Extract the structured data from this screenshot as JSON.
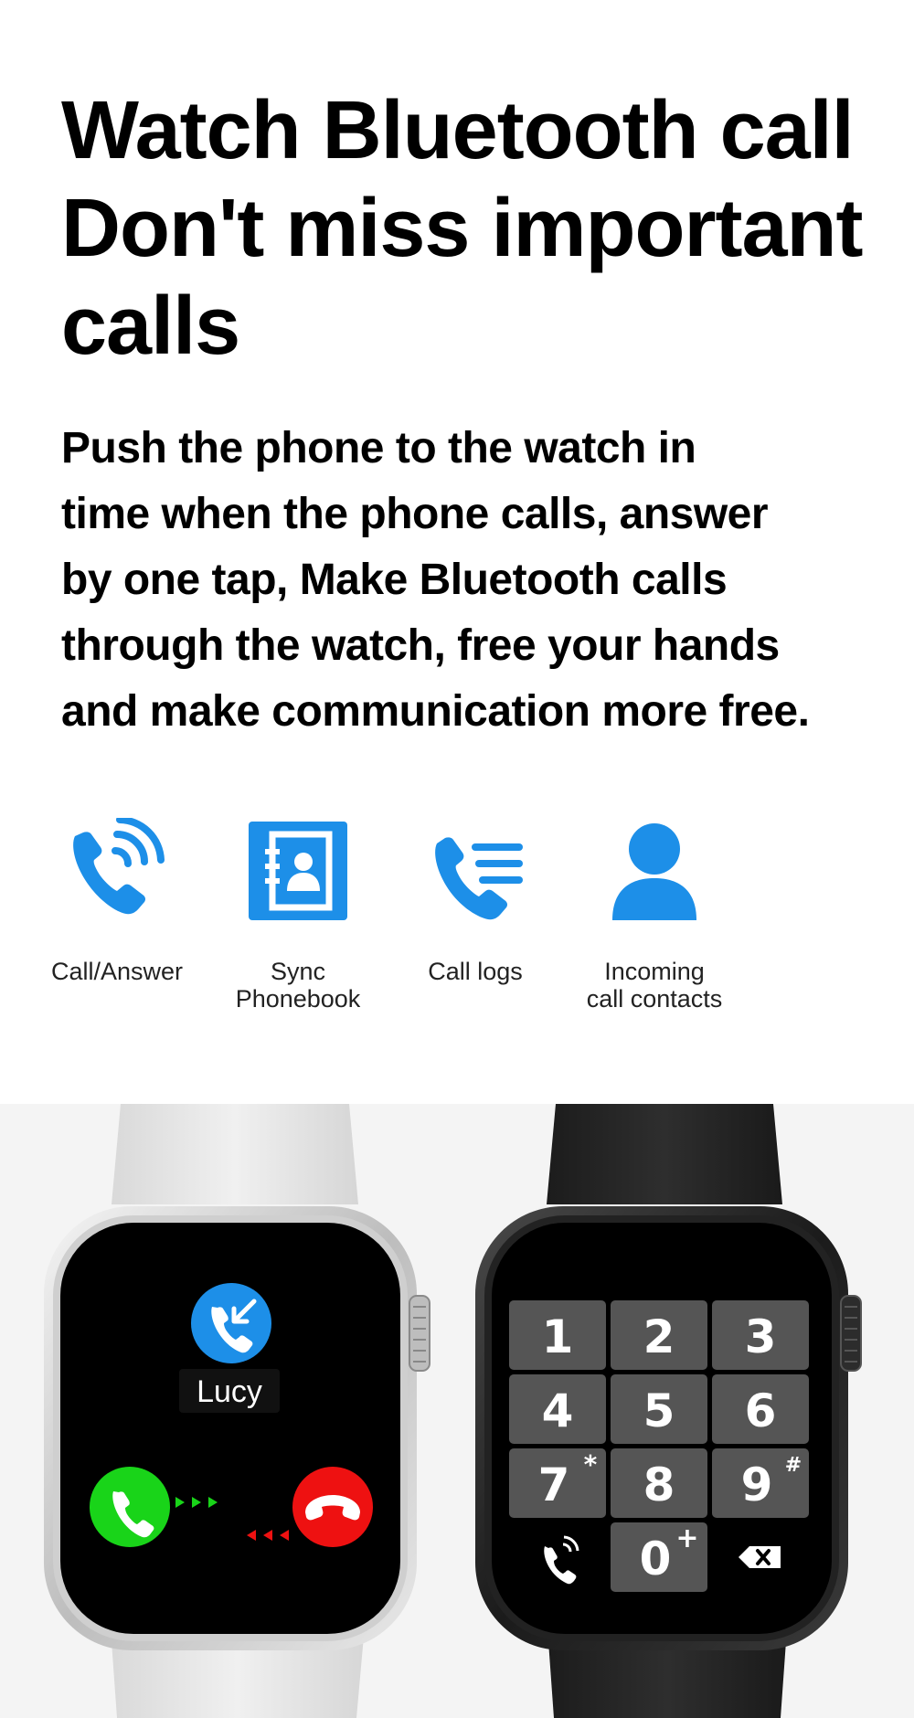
{
  "headline": {
    "lines": [
      "Watch Bluetooth call",
      "Don't miss important",
      "calls"
    ]
  },
  "description": {
    "lines": [
      "Push the phone to the watch in",
      "time when the phone calls, answer",
      "by one tap, Make Bluetooth calls",
      "through the watch, free your hands",
      "and make communication more free."
    ]
  },
  "features": [
    {
      "icon": "phone-ringing-icon",
      "lines": [
        "Call/Answer"
      ]
    },
    {
      "icon": "phonebook-icon",
      "lines": [
        "Sync",
        "Phonebook"
      ]
    },
    {
      "icon": "call-log-icon",
      "lines": [
        "Call logs"
      ]
    },
    {
      "icon": "user-icon",
      "lines": [
        "Incoming",
        "call contacts"
      ]
    }
  ],
  "watch_incoming": {
    "caller": "Lucy",
    "accept_color": "#19d419",
    "decline_color": "#ee1111",
    "caller_icon_color": "#1d8fe8"
  },
  "watch_dialpad": {
    "keys": [
      "1",
      "2",
      "3",
      "4",
      "5",
      "6",
      "7",
      "8",
      "9",
      "0"
    ],
    "superscripts": {
      "7": "*",
      "9": "#",
      "0": "+"
    }
  },
  "colors": {
    "accent_blue": "#1d8fe8",
    "text": "#000000"
  }
}
